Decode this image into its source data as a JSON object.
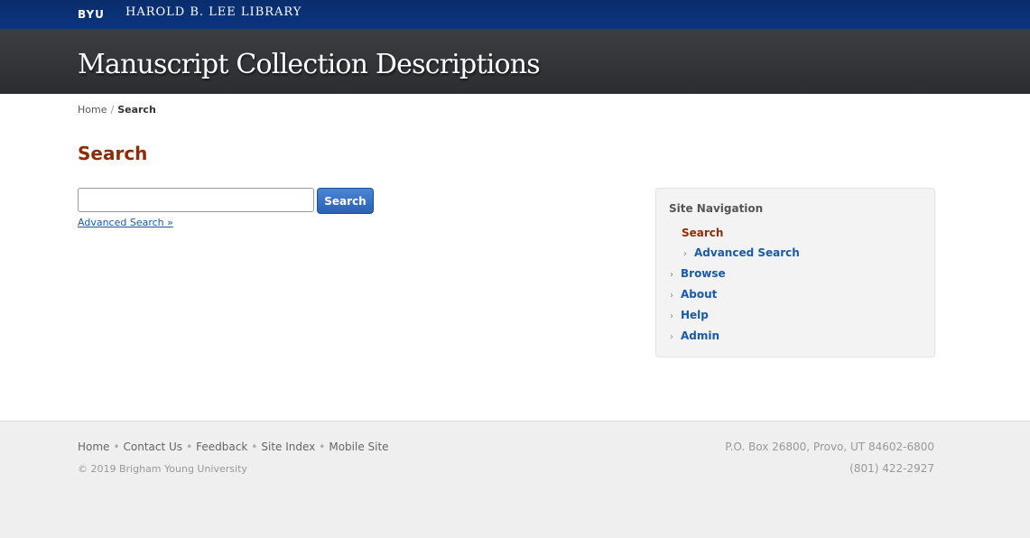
{
  "topbar": {
    "byu": "BYU",
    "library": "HAROLD B. LEE LIBRARY"
  },
  "header": {
    "title": "Manuscript Collection Descriptions"
  },
  "breadcrumb": {
    "home": "Home",
    "separator": "/",
    "current": "Search"
  },
  "main": {
    "title": "Search",
    "search_value": "",
    "search_button": "Search",
    "advanced_link": "Advanced Search »"
  },
  "sidebar": {
    "heading": "Site Navigation",
    "items": [
      {
        "label": "Search",
        "active": true
      },
      {
        "label": "Advanced Search",
        "sub": true
      },
      {
        "label": "Browse"
      },
      {
        "label": "About"
      },
      {
        "label": "Help"
      },
      {
        "label": "Admin"
      }
    ]
  },
  "footer": {
    "links": [
      "Home",
      "Contact Us",
      "Feedback",
      "Site Index",
      "Mobile Site"
    ],
    "copyright": "© 2019 Brigham Young University",
    "address": "P.O. Box 26800, Provo, UT 84602-6800",
    "phone": "(801) 422-2927"
  },
  "colors": {
    "topbar": "#0b3580",
    "header": "#2b2d31",
    "title_accent": "#8e2b08",
    "link": "#1a5aa8",
    "button": "#2b62b3"
  }
}
